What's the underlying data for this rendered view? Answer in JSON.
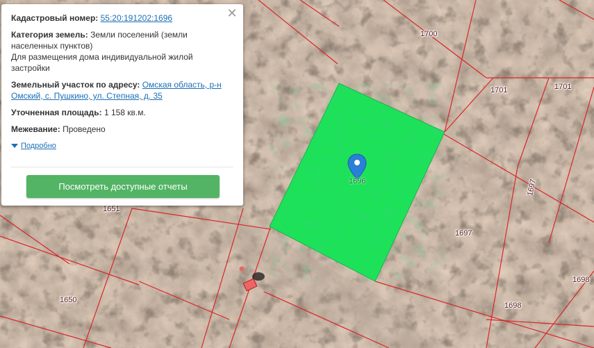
{
  "popup": {
    "cadastral_label": "Кадастровый номер:",
    "cadastral_value": "55:20:191202:1696",
    "category_label": "Категория земель:",
    "category_value": "Земли поселений (земли населенных пунктов)",
    "permitted_use": "Для размещения дома индивидуальной жилой застройки",
    "address_label": "Земельный участок по адресу:",
    "address_value": "Омская область, р-н Омский, с. Пушкино, ул. Степная, д. 35",
    "area_label": "Уточненная площадь:",
    "area_value": "1 158 кв.м.",
    "survey_label": "Межевание:",
    "survey_value": "Проведено",
    "details_link": "Подробно",
    "reports_button": "Посмотреть доступные отчеты",
    "close_glyph": "✕"
  },
  "map": {
    "selected_parcel_label": "1696",
    "selected_fill_color": "#1ee15a",
    "boundary_color": "#d8262a",
    "parcel_labels": {
      "p1700": "1700",
      "p1701a": "1701",
      "p1701b": "1701",
      "p1697a": "1697",
      "p1697b": "1697",
      "p1698a": "1698",
      "p1698b": "1698",
      "p1651": "1651",
      "p1650": "1650"
    }
  }
}
